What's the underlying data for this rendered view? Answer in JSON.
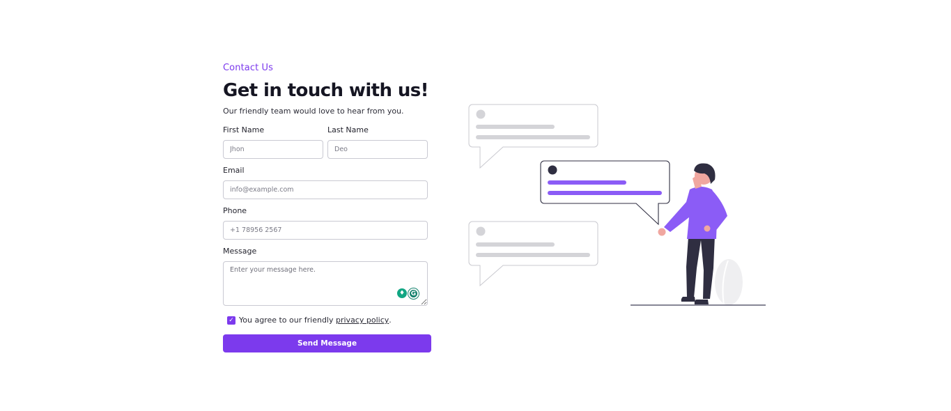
{
  "header": {
    "eyebrow": "Contact Us",
    "title": "Get in touch with us!",
    "subtitle": "Our friendly team would love to hear from you."
  },
  "form": {
    "first_name": {
      "label": "First Name",
      "placeholder": "Jhon"
    },
    "last_name": {
      "label": "Last Name",
      "placeholder": "Deo"
    },
    "email": {
      "label": "Email",
      "placeholder": "info@example.com"
    },
    "phone": {
      "label": "Phone",
      "placeholder": "+1 78956 2567"
    },
    "message": {
      "label": "Message",
      "placeholder": "Enter your message here."
    },
    "agree": {
      "text_before": "You agree to our friendly ",
      "link": "privacy policy",
      "text_after": ".",
      "checked": true
    },
    "submit_label": "Send Message"
  },
  "colors": {
    "accent": "#7c3aed",
    "bubble_accent": "#8b5cf6",
    "text_dark": "#151522",
    "placeholder_line": "#d4d4d8"
  },
  "icons": [
    "checkmark-icon",
    "bulb-extension-icon",
    "grammarly-icon",
    "contact-illustration"
  ]
}
